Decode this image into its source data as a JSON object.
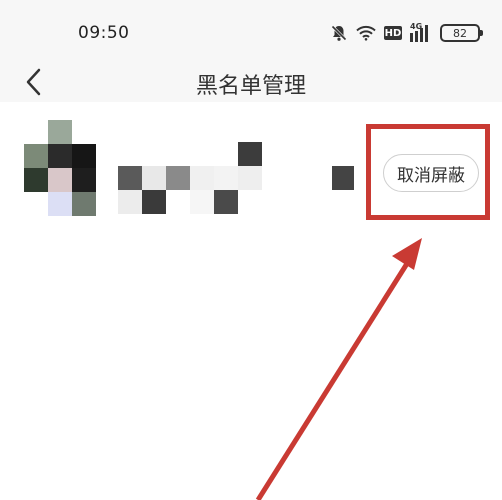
{
  "status_bar": {
    "time": "09:50",
    "network_label": "4G",
    "hd_label": "HD",
    "battery_level": "82",
    "icons": [
      "mute-bell-icon",
      "wifi-icon",
      "hd-icon",
      "signal-4g-icon",
      "battery-icon"
    ]
  },
  "nav": {
    "back_icon": "chevron-left-icon",
    "title": "黑名单管理"
  },
  "blocked_list": {
    "items": [
      {
        "avatar": "pixelated-avatar",
        "name_obscured": true,
        "unblock_label": "取消屏蔽"
      }
    ]
  },
  "annotations": {
    "highlight_color": "#c93a33",
    "arrow_color": "#c93a33"
  }
}
